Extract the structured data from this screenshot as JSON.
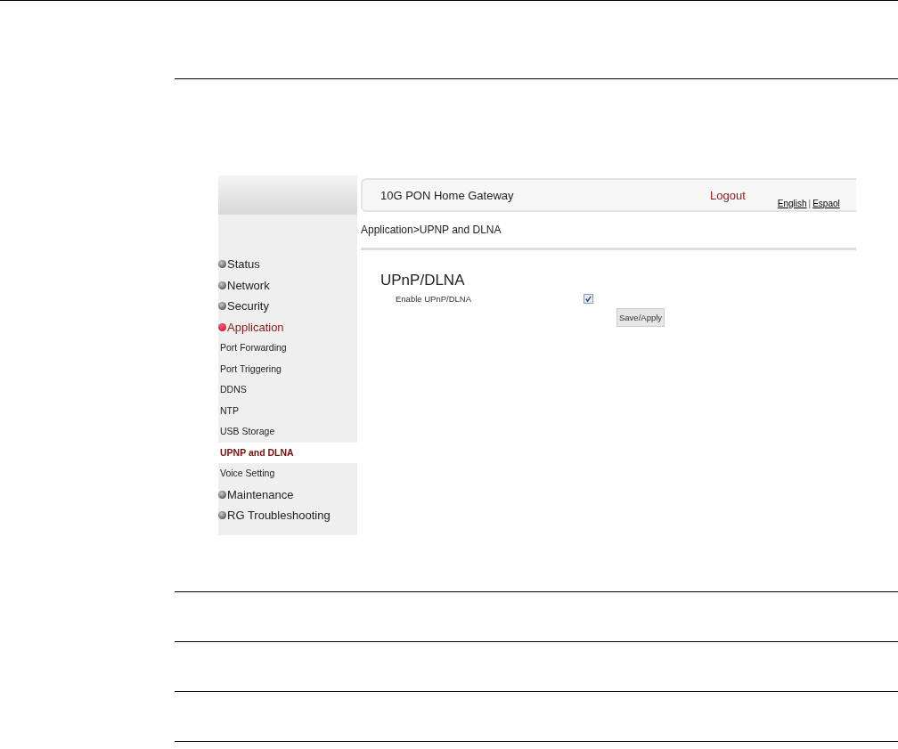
{
  "header": {
    "title": "10G PON Home Gateway",
    "logout": "Logout",
    "languages": [
      {
        "label": "English"
      },
      {
        "label": "Espaol"
      }
    ],
    "separator": "|"
  },
  "sidebar": {
    "items": [
      {
        "label": "Status",
        "expanded": false
      },
      {
        "label": "Network",
        "expanded": false
      },
      {
        "label": "Security",
        "expanded": false
      },
      {
        "label": "Application",
        "expanded": true,
        "children": [
          {
            "label": "Port Forwarding",
            "selected": false
          },
          {
            "label": "Port Triggering",
            "selected": false
          },
          {
            "label": "DDNS",
            "selected": false
          },
          {
            "label": "NTP",
            "selected": false
          },
          {
            "label": "USB Storage",
            "selected": false
          },
          {
            "label": "UPNP and DLNA",
            "selected": true
          },
          {
            "label": "Voice Setting",
            "selected": false
          }
        ]
      },
      {
        "label": "Maintenance",
        "expanded": false
      },
      {
        "label": "RG Troubleshooting",
        "expanded": false
      }
    ]
  },
  "breadcrumb": "Application>UPNP and DLNA",
  "content": {
    "heading": "UPnP/DLNA",
    "fields": [
      {
        "label": "Enable UPnP/DLNA",
        "checked": true
      }
    ],
    "button": "Save/Apply"
  }
}
